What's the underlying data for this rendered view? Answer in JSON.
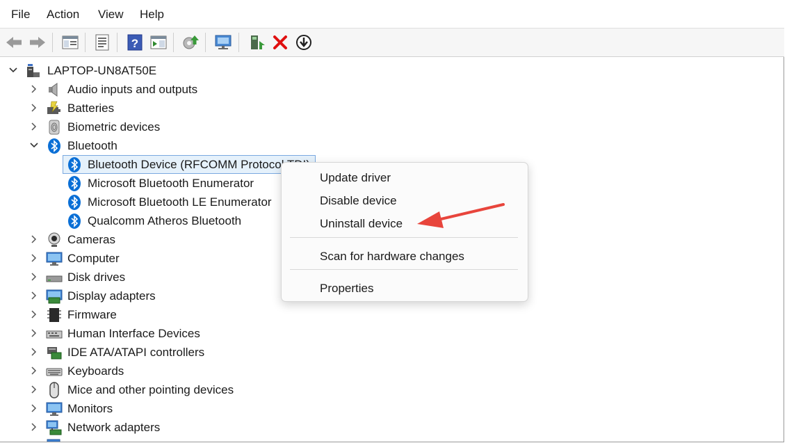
{
  "menubar": {
    "items": [
      "File",
      "Action",
      "View",
      "Help"
    ]
  },
  "toolbar": {
    "icons": [
      "back-arrow-icon",
      "forward-arrow-icon",
      "show-hide-console-tree-icon",
      "properties-sheet-icon",
      "help-icon",
      "action-pane-icon",
      "update-driver-icon",
      "scan-hardware-icon",
      "enable-device-icon",
      "uninstall-device-x-icon",
      "download-driver-icon"
    ]
  },
  "tree": {
    "root": "LAPTOP-UN8AT50E",
    "categories": [
      {
        "label": "Audio inputs and outputs",
        "icon": "speaker-icon",
        "expanded": false
      },
      {
        "label": "Batteries",
        "icon": "battery-icon",
        "expanded": false
      },
      {
        "label": "Biometric devices",
        "icon": "fingerprint-icon",
        "expanded": false
      },
      {
        "label": "Bluetooth",
        "icon": "bluetooth-icon",
        "expanded": true,
        "children": [
          "Bluetooth Device (RFCOMM Protocol TDI)",
          "Microsoft Bluetooth Enumerator",
          "Microsoft Bluetooth LE Enumerator",
          "Qualcomm Atheros Bluetooth"
        ]
      },
      {
        "label": "Cameras",
        "icon": "camera-icon",
        "expanded": false
      },
      {
        "label": "Computer",
        "icon": "monitor-icon",
        "expanded": false
      },
      {
        "label": "Disk drives",
        "icon": "disk-drive-icon",
        "expanded": false
      },
      {
        "label": "Display adapters",
        "icon": "display-adapter-icon",
        "expanded": false
      },
      {
        "label": "Firmware",
        "icon": "firmware-chip-icon",
        "expanded": false
      },
      {
        "label": "Human Interface Devices",
        "icon": "hid-icon",
        "expanded": false
      },
      {
        "label": "IDE ATA/ATAPI controllers",
        "icon": "ide-controller-icon",
        "expanded": false
      },
      {
        "label": "Keyboards",
        "icon": "keyboard-icon",
        "expanded": false
      },
      {
        "label": "Mice and other pointing devices",
        "icon": "mouse-icon",
        "expanded": false
      },
      {
        "label": "Monitors",
        "icon": "monitor-icon",
        "expanded": false
      },
      {
        "label": "Network adapters",
        "icon": "network-adapter-icon",
        "expanded": false
      }
    ]
  },
  "context_menu": {
    "items": [
      "Update driver",
      "Disable device",
      "Uninstall device",
      "Scan for hardware changes",
      "Properties"
    ]
  },
  "colors": {
    "selection_bg": "#e5f1fb",
    "selection_border": "#7aa9e0",
    "bluetooth_blue": "#0a6fd6",
    "annotation_arrow": "#e8453c"
  }
}
